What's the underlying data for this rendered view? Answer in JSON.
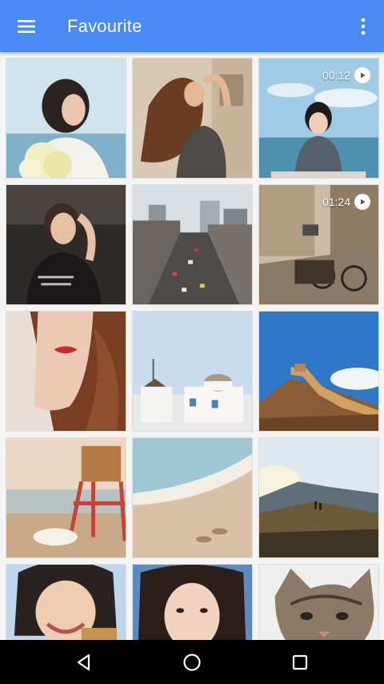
{
  "app_bar": {
    "title": "Favourite",
    "menu_icon": "hamburger-menu-icon",
    "overflow_icon": "more-vert-icon",
    "color": "#4a8af4"
  },
  "grid": {
    "items": [
      {
        "subject": "girl-with-flowers-photo"
      },
      {
        "subject": "woman-hair-blowing-photo"
      },
      {
        "subject": "girl-sitting-by-sea-video",
        "duration": "00:12"
      },
      {
        "subject": "woman-portrait-photo"
      },
      {
        "subject": "city-street-aerial-photo"
      },
      {
        "subject": "rainy-street-bicycles-video",
        "duration": "01:24"
      },
      {
        "subject": "woman-closeup-red-lips-photo"
      },
      {
        "subject": "white-village-windmill-photo"
      },
      {
        "subject": "great-wall-photo"
      },
      {
        "subject": "lifeguard-tower-beach-photo"
      },
      {
        "subject": "footprints-on-beach-photo"
      },
      {
        "subject": "mountain-sunset-hikers-photo"
      },
      {
        "subject": "smiling-girl-photo"
      },
      {
        "subject": "girl-portrait-photo"
      },
      {
        "subject": "kitten-photo"
      }
    ]
  },
  "nav_bar": {
    "back_icon": "back-triangle-icon",
    "home_icon": "home-circle-icon",
    "recents_icon": "recents-square-icon"
  }
}
